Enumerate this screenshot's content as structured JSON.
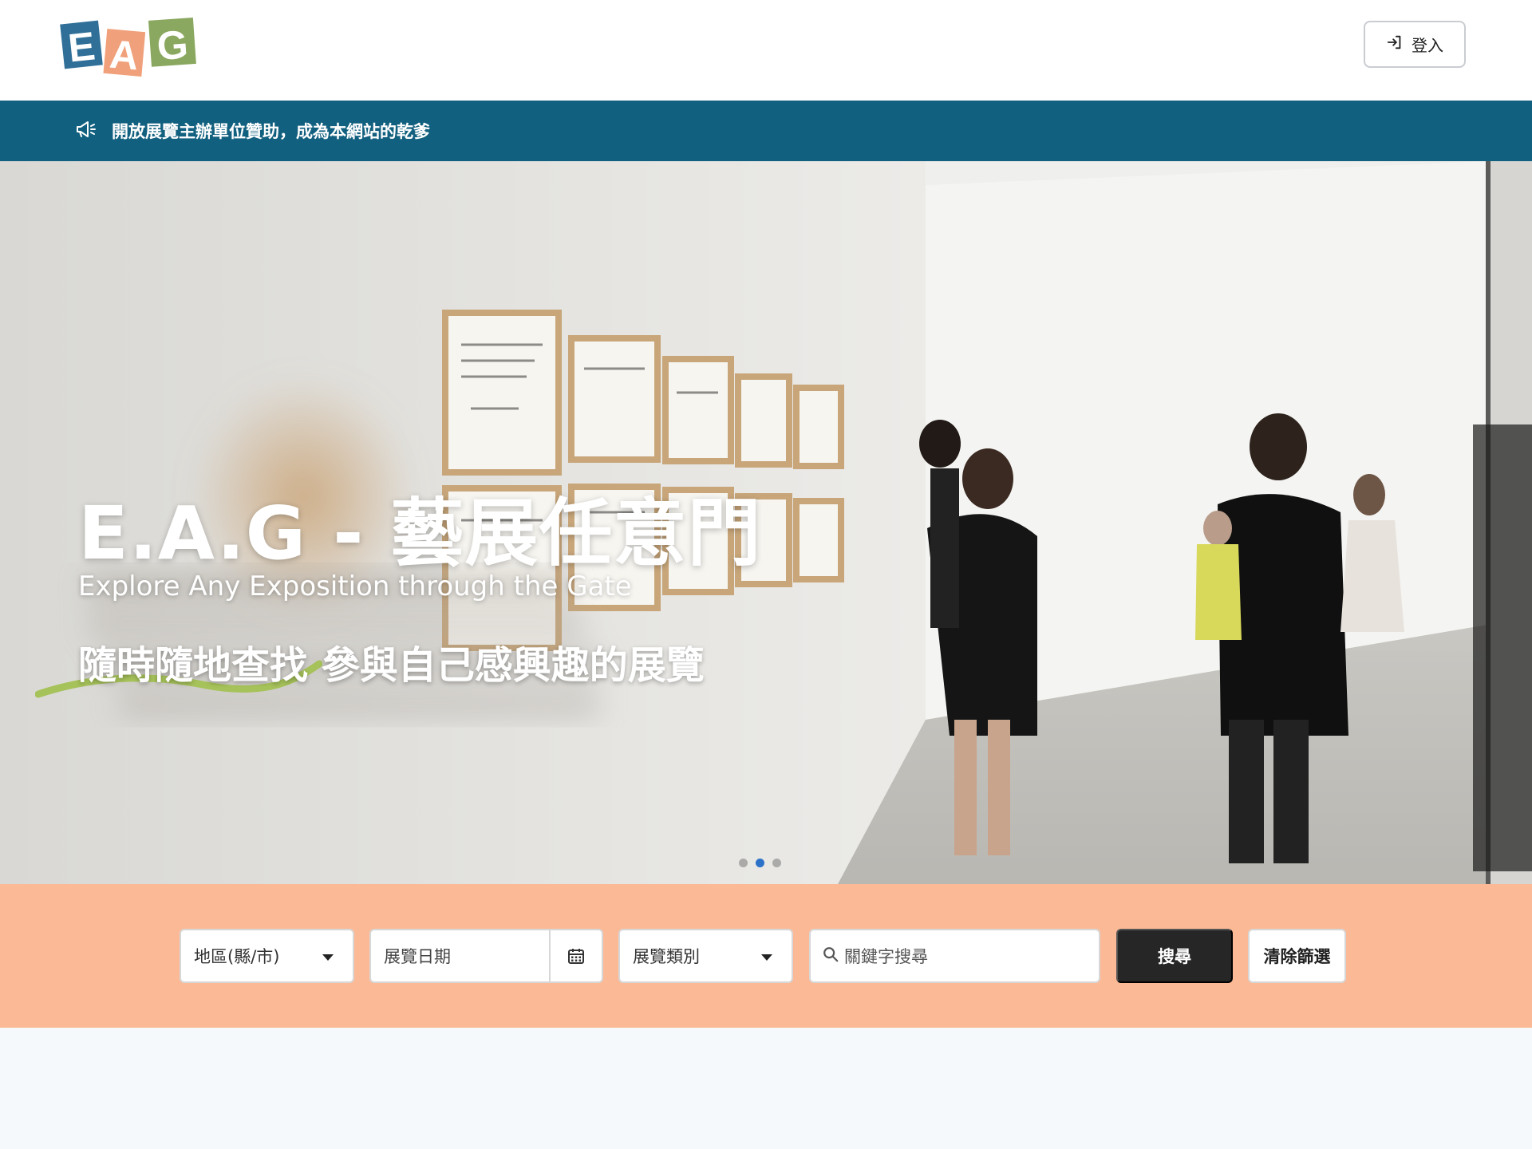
{
  "header": {
    "logo_text": "EAG",
    "login_label": "登入"
  },
  "banner": {
    "text": "開放展覽主辦單位贊助，成為本網站的乾爹"
  },
  "hero": {
    "title": "E.A.G - 藝展任意門",
    "subtitle_en": "Explore Any Exposition through the Gate",
    "subtitle_zh": "隨時隨地查找 參與自己感興趣的展覽",
    "carousel_total": 3,
    "carousel_active_index": 1
  },
  "filters": {
    "region_label": "地區(縣/市)",
    "date_placeholder": "展覽日期",
    "category_label": "展覽類別",
    "keyword_placeholder": "關鍵字搜尋",
    "search_label": "搜尋",
    "clear_label": "清除篩選"
  },
  "colors": {
    "banner_bg": "#12607f",
    "filter_bg": "#fbb996",
    "search_btn_bg": "#262626",
    "carousel_active": "#2c72c8",
    "logo_blue": "#2f6f98",
    "logo_orange": "#f0a07a",
    "logo_green": "#8aa85f",
    "squiggle_green": "#a6c25a"
  }
}
